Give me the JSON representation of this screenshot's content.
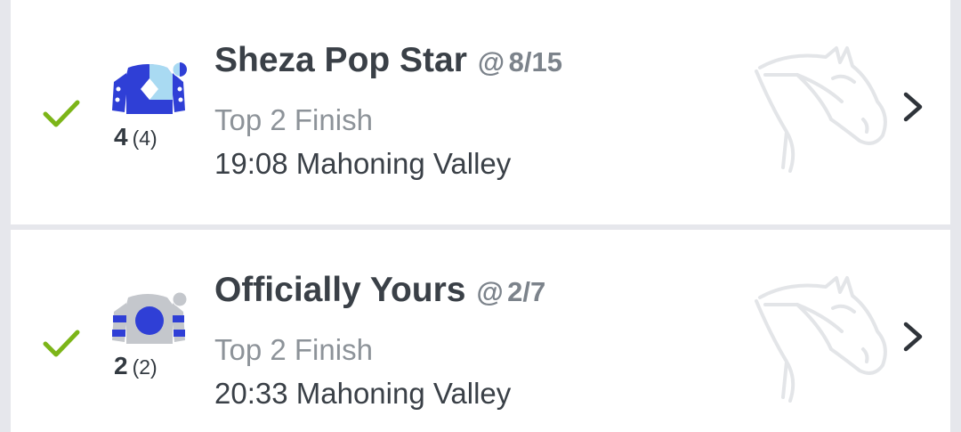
{
  "bets": [
    {
      "status": "won",
      "horse_name": "Sheza Pop Star",
      "at_symbol": "@",
      "odds": "8/15",
      "runner_number": "4",
      "draw": "(4)",
      "bet_type": "Top 2 Finish",
      "race": "19:08 Mahoning Valley",
      "silk_colors": {
        "primary": "#2f3fd6",
        "secondary": "#a9daf2",
        "accent": "#ffffff"
      }
    },
    {
      "status": "won",
      "horse_name": "Officially Yours",
      "at_symbol": "@",
      "odds": "2/7",
      "runner_number": "2",
      "draw": "(2)",
      "bet_type": "Top 2 Finish",
      "race": "20:33 Mahoning Valley",
      "silk_colors": {
        "primary": "#c4c7cc",
        "secondary": "#2f3fd6",
        "accent": "#ffffff"
      }
    }
  ],
  "icons": {
    "check": "check-icon",
    "silk": "jockey-silk-icon",
    "horse": "horse-head-icon",
    "chevron": "chevron-right-icon"
  },
  "colors": {
    "check_green": "#7cb518",
    "background": "#e6e7ec",
    "card": "#ffffff",
    "horse_art": "#e3e5e8"
  }
}
